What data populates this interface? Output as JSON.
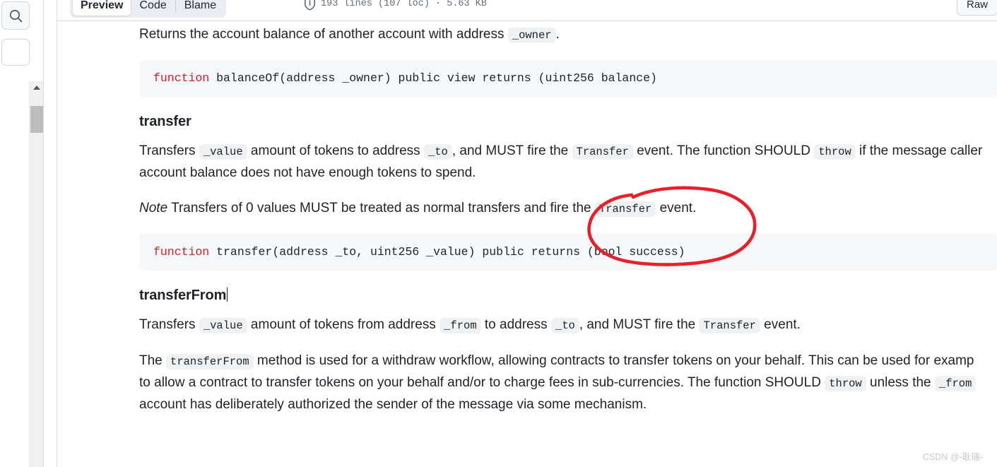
{
  "left_rail": {
    "search_button": {
      "icon": "search-icon",
      "label": ""
    },
    "secondary_button": {
      "label": ""
    },
    "scrollbar": {
      "up_arrow_icon": "caret-up-icon"
    }
  },
  "header": {
    "tabs": [
      {
        "id": "preview",
        "label": "Preview",
        "active": true
      },
      {
        "id": "code",
        "label": "Code",
        "active": false
      },
      {
        "id": "blame",
        "label": "Blame",
        "active": false
      }
    ],
    "file_meta": {
      "shield_icon": "shield-check-icon",
      "text": "193 lines (107 loc) · 5.63 KB",
      "lines": "193 lines",
      "loc": "(107 loc)",
      "size": "5.63 KB"
    },
    "raw_button_label": "Raw"
  },
  "content": {
    "balanceof_desc": {
      "part1": "Returns the account balance of another account with address ",
      "code1": "_owner",
      "part2": "."
    },
    "codeblock_balanceof": {
      "keyword": "function",
      "rest": " balanceOf(address _owner) public view returns (uint256 balance)",
      "copy_icon": "copy-icon"
    },
    "heading_transfer": "transfer",
    "transfer_desc": {
      "part1": "Transfers ",
      "code1": "_value",
      "part2": " amount of tokens to address ",
      "code2": "_to",
      "part3": ", and MUST fire the ",
      "code3": "Transfer",
      "part4": " event. The function SHOULD ",
      "code4": "throw",
      "part5": " if the message caller",
      "line2": "account balance does not have enough tokens to spend."
    },
    "transfer_note": {
      "note_label": "Note",
      "part1": " Transfers of 0 values MUST be treated as normal transfers and fire the ",
      "code1": "Transfer",
      "part2": " event."
    },
    "codeblock_transfer": {
      "keyword": "function",
      "rest": " transfer(address _to, uint256 _value) public returns (bool success)",
      "copy_icon": "copy-icon"
    },
    "heading_transferfrom": "transferFrom",
    "transferfrom_desc": {
      "part1": "Transfers ",
      "code1": "_value",
      "part2": " amount of tokens from address ",
      "code2": "_from",
      "part3": " to address ",
      "code3": "_to",
      "part4": ", and MUST fire the ",
      "code4": "Transfer",
      "part5": " event."
    },
    "transferfrom_detail": {
      "part1": "The ",
      "code1": "transferFrom",
      "part2": " method is used for a withdraw workflow, allowing contracts to transfer tokens on your behalf. This can be used for examp",
      "line2_part1": "to allow a contract to transfer tokens on your behalf and/or to charge fees in sub-currencies. The function SHOULD ",
      "line2_code": "throw",
      "line2_part2": " unless the ",
      "line2_code2": "_from",
      "line3": "account has deliberately authorized the sender of the message via some mechanism."
    }
  },
  "annotation": {
    "shape": "red-ellipse-circle",
    "color": "#e8202a",
    "targets": "Transfer event"
  },
  "watermark": "CSDN @-耿瑞-",
  "colors": {
    "accent_red": "#cf222e",
    "annotation_red": "#e8202a",
    "code_bg": "#f6f8fa",
    "inline_code_bg": "#eff1f3",
    "text": "#1f2328",
    "muted": "#636c76",
    "border": "#d8dee4"
  }
}
